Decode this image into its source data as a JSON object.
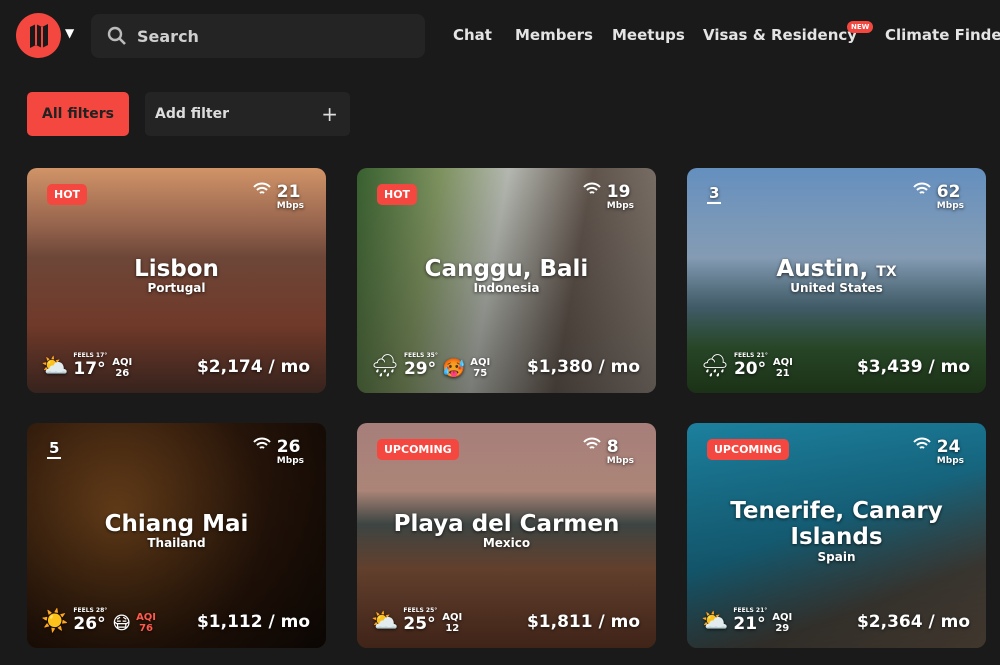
{
  "header": {
    "search_placeholder": "Search",
    "nav": [
      "Chat",
      "Members",
      "Meetups",
      "Visas & Residency",
      "Climate Finder"
    ],
    "new_badge": "NEW"
  },
  "filters": {
    "all": "All filters",
    "add": "Add filter",
    "plus": "+"
  },
  "accent": "#f4473f",
  "cards": [
    {
      "badge": "HOT",
      "mbps": "21",
      "unit": "Mbps",
      "city": "Lisbon",
      "suffix": "",
      "country": "Portugal",
      "feels": "FEELS 17°",
      "temp": "17°",
      "aqi_label": "AQI",
      "aqi": "26",
      "weather_icon": "sun-cloud",
      "aqi_icon": "",
      "price": "$2,174 / mo"
    },
    {
      "badge": "HOT",
      "mbps": "19",
      "unit": "Mbps",
      "city": "Canggu, Bali",
      "suffix": "",
      "country": "Indonesia",
      "feels": "FEELS 35°",
      "temp": "29°",
      "aqi_label": "AQI",
      "aqi": "75",
      "weather_icon": "rain",
      "aqi_icon": "🥵",
      "price": "$1,380 / mo"
    },
    {
      "rank": "3",
      "mbps": "62",
      "unit": "Mbps",
      "city": "Austin,",
      "suffix": "TX",
      "country": "United States",
      "feels": "FEELS 21°",
      "temp": "20°",
      "aqi_label": "AQI",
      "aqi": "21",
      "weather_icon": "rain",
      "aqi_icon": "",
      "price": "$3,439 / mo"
    },
    {
      "rank": "5",
      "mbps": "26",
      "unit": "Mbps",
      "city": "Chiang Mai",
      "suffix": "",
      "country": "Thailand",
      "feels": "FEELS 28°",
      "temp": "26°",
      "aqi_label": "AQI",
      "aqi": "76",
      "weather_icon": "sun",
      "aqi_icon": "😷",
      "price": "$1,112 / mo"
    },
    {
      "badge": "UPCOMING",
      "mbps": "8",
      "unit": "Mbps",
      "city": "Playa del Carmen",
      "suffix": "",
      "country": "Mexico",
      "feels": "FEELS 25°",
      "temp": "25°",
      "aqi_label": "AQI",
      "aqi": "12",
      "weather_icon": "sun-cloud",
      "aqi_icon": "",
      "price": "$1,811 / mo"
    },
    {
      "badge": "UPCOMING",
      "mbps": "24",
      "unit": "Mbps",
      "city": "Tenerife, Canary Islands",
      "suffix": "",
      "country": "Spain",
      "feels": "FEELS 21°",
      "temp": "21°",
      "aqi_label": "AQI",
      "aqi": "29",
      "weather_icon": "sun-cloud",
      "aqi_icon": "",
      "price": "$2,364 / mo"
    }
  ]
}
